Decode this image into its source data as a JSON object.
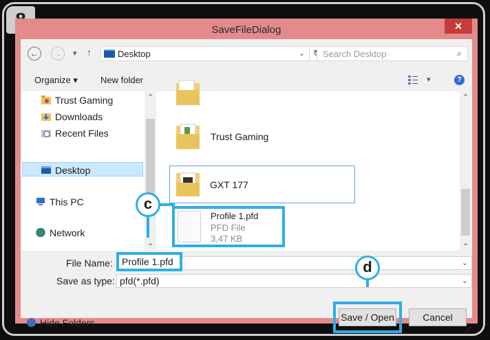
{
  "step_badge": "8",
  "window": {
    "title": "SaveFileDialog",
    "close_glyph": "✕"
  },
  "address_bar": {
    "back_icon": "arrow-left",
    "forward_icon": "arrow-right",
    "up_icon": "arrow-up",
    "path_label": "Desktop",
    "search_placeholder": "Search Desktop"
  },
  "toolbar": {
    "organize_label": "Organize ▾",
    "new_folder_label": "New folder",
    "help_glyph": "?"
  },
  "nav_pane": {
    "items": [
      {
        "label": "Trust Gaming",
        "icon": "folder-icon"
      },
      {
        "label": "Downloads",
        "icon": "downloads-icon"
      },
      {
        "label": "Recent Files",
        "icon": "recent-files-icon"
      },
      {
        "label": "Desktop",
        "icon": "desktop-icon",
        "selected": true
      },
      {
        "label": "This PC",
        "icon": "computer-icon"
      },
      {
        "label": "Network",
        "icon": "network-icon"
      }
    ]
  },
  "content": {
    "items": [
      {
        "name": "Trust Gaming",
        "type": "folder"
      },
      {
        "name": "GXT 177",
        "type": "folder"
      },
      {
        "name": "Profile 1.pfd",
        "file_type": "PFD File",
        "size": "3,47 KB"
      }
    ]
  },
  "bottom": {
    "file_name_label": "File Name:",
    "file_name_value": "Profile 1.pfd",
    "save_type_label": "Save as type:",
    "save_type_value": "pfd(*.pfd)",
    "hide_folders_label": "Hide Folders",
    "save_button": "Save / Open",
    "cancel_button": "Cancel"
  },
  "callouts": {
    "c": "c",
    "d": "d"
  },
  "colors": {
    "highlight": "#2eaee6",
    "title_bar": "#e48a8a",
    "close_button": "#c73b3b"
  }
}
